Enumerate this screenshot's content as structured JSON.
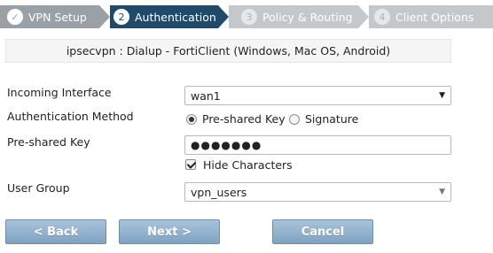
{
  "wizard": {
    "steps": [
      {
        "number": "✓",
        "label": "VPN Setup",
        "state": "done"
      },
      {
        "number": "2",
        "label": "Authentication",
        "state": "active"
      },
      {
        "number": "3",
        "label": "Policy & Routing",
        "state": "todo"
      },
      {
        "number": "4",
        "label": "Client Options",
        "state": "todo"
      }
    ]
  },
  "title": "ipsecvpn : Dialup - FortiClient (Windows, Mac OS, Android)",
  "form": {
    "incoming_interface": {
      "label": "Incoming Interface",
      "value": "wan1"
    },
    "auth_method": {
      "label": "Authentication Method",
      "options": [
        "Pre-shared Key",
        "Signature"
      ],
      "selected": "Pre-shared Key"
    },
    "psk": {
      "label": "Pre-shared Key",
      "value": "●●●●●●●"
    },
    "hide_characters": {
      "label": "Hide Characters",
      "checked": true
    },
    "user_group": {
      "label": "User Group",
      "value": "vpn_users"
    }
  },
  "buttons": {
    "back": "< Back",
    "next": "Next >",
    "cancel": "Cancel"
  },
  "colors": {
    "active_step": "#1f4a6a",
    "done_step": "#9aa1a6",
    "todo_step": "#c5c8cb",
    "button": "#8fb0cd"
  }
}
